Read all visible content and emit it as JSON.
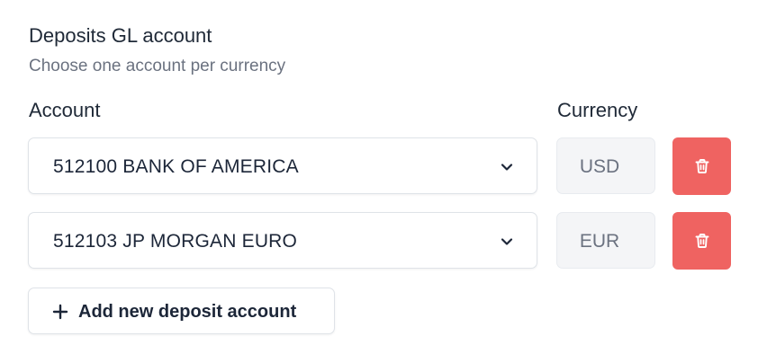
{
  "section": {
    "title": "Deposits GL account",
    "subtitle": "Choose one account per currency"
  },
  "columns": {
    "account": "Account",
    "currency": "Currency"
  },
  "rows": [
    {
      "account": "512100 BANK OF AMERICA",
      "currency": "USD",
      "dropdown_icon": "chevron-down-icon",
      "delete_icon": "trash-icon"
    },
    {
      "account": "512103 JP MORGAN EURO",
      "currency": "EUR",
      "dropdown_icon": "chevron-down-icon",
      "delete_icon": "trash-icon"
    }
  ],
  "add_button": {
    "icon": "plus-icon",
    "label": "Add new deposit account"
  },
  "colors": {
    "delete_button": "#ef6361",
    "currency_background": "#f4f5f7",
    "text_primary": "#1c2638",
    "text_muted": "#6b7280"
  }
}
